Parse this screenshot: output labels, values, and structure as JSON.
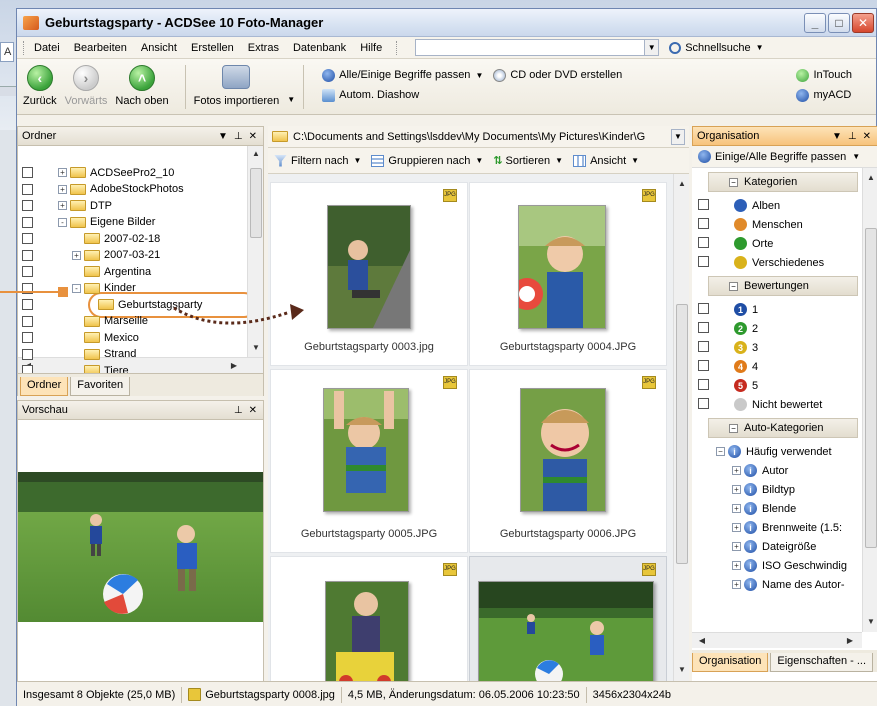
{
  "bg": {
    "left_button": "A"
  },
  "window": {
    "title": "Geburtstagsparty - ACDSee 10 Foto-Manager"
  },
  "menu": {
    "items": [
      "Datei",
      "Bearbeiten",
      "Ansicht",
      "Erstellen",
      "Extras",
      "Datenbank",
      "Hilfe"
    ],
    "search_value": "",
    "quicksearch": "Schnellsuche"
  },
  "toolbar": {
    "back": "Zurück",
    "forward": "Vorwärts",
    "up": "Nach oben",
    "import": "Fotos importieren",
    "match_terms": "Alle/Einige Begriffe passen",
    "burn": "CD oder DVD erstellen",
    "slideshow": "Autom. Diashow",
    "intouch": "InTouch",
    "myacd": "myACD"
  },
  "folders": {
    "title": "Ordner",
    "tree": [
      {
        "label": "ACDSeePro2_10",
        "depth": 1,
        "pm": "+"
      },
      {
        "label": "AdobeStockPhotos",
        "depth": 1,
        "pm": "+"
      },
      {
        "label": "DTP",
        "depth": 1,
        "pm": "+"
      },
      {
        "label": "Eigene Bilder",
        "depth": 1,
        "pm": "-"
      },
      {
        "label": "2007-02-18",
        "depth": 2,
        "pm": ""
      },
      {
        "label": "2007-03-21",
        "depth": 2,
        "pm": "+"
      },
      {
        "label": "Argentina",
        "depth": 2,
        "pm": ""
      },
      {
        "label": "Kinder",
        "depth": 2,
        "pm": "-"
      },
      {
        "label": "Geburtstagsparty",
        "depth": 3,
        "pm": ""
      },
      {
        "label": "Marseille",
        "depth": 2,
        "pm": ""
      },
      {
        "label": "Mexico",
        "depth": 2,
        "pm": ""
      },
      {
        "label": "Strand",
        "depth": 2,
        "pm": ""
      },
      {
        "label": "Tiere",
        "depth": 2,
        "pm": ""
      }
    ],
    "tabs": [
      "Ordner",
      "Favoriten"
    ]
  },
  "preview": {
    "title": "Vorschau"
  },
  "browser": {
    "path": "C:\\Documents and Settings\\lsddev\\My Documents\\My Pictures\\Kinder\\G",
    "filter": "Filtern nach",
    "group": "Gruppieren nach",
    "sort": "Sortieren",
    "view": "Ansicht",
    "thumbnails": [
      {
        "caption": "Geburtstagsparty 0003.jpg",
        "badge": "JPG"
      },
      {
        "caption": "Geburtstagsparty 0004.JPG",
        "badge": "JPG"
      },
      {
        "caption": "Geburtstagsparty 0005.JPG",
        "badge": "JPG"
      },
      {
        "caption": "Geburtstagsparty 0006.JPG",
        "badge": "JPG"
      },
      {
        "caption": "",
        "badge": "JPG"
      },
      {
        "caption": "",
        "badge": "JPG"
      }
    ]
  },
  "organize": {
    "title": "Organisation",
    "match": "Einige/Alle Begriffe passen",
    "categories_title": "Kategorien",
    "categories": [
      "Alben",
      "Menschen",
      "Orte",
      "Verschiedenes"
    ],
    "ratings_title": "Bewertungen",
    "ratings": [
      "1",
      "2",
      "3",
      "4",
      "5",
      "Nicht bewertet"
    ],
    "rating_colors": [
      "#1f4ea5",
      "#2e9a2e",
      "#d9b21b",
      "#e07b1a",
      "#c62b1f",
      "#c9c9c9"
    ],
    "auto_title": "Auto-Kategorien",
    "auto_root": "Häufig verwendet",
    "auto_items": [
      "Autor",
      "Bildtyp",
      "Blende",
      "Brennweite (1.5:",
      "Dateigröße",
      "ISO Geschwindig",
      "Name des Autor-"
    ],
    "tabs": [
      "Organisation",
      "Eigenschaften - ..."
    ]
  },
  "status": {
    "total": "Insgesamt 8 Objekte (25,0 MB)",
    "file": "Geburtstagsparty 0008.jpg",
    "info": "4,5 MB, Änderungsdatum: 06.05.2006 10:23:50",
    "dims": "3456x2304x24b"
  }
}
